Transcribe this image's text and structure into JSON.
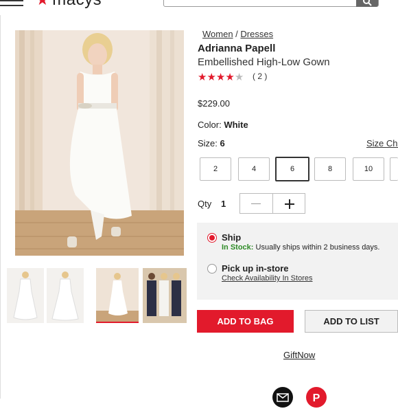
{
  "header": {
    "logo_text": "macys"
  },
  "breadcrumb": {
    "level1": "Women",
    "separator": " / ",
    "level2": "Dresses"
  },
  "product": {
    "brand": "Adrianna Papell",
    "name": "Embellished High-Low Gown",
    "rating_value": 4,
    "rating_max": 5,
    "review_count": "( 2 )",
    "price": "$229.00",
    "color_label": "Color:",
    "color_value": "White",
    "size_label": "Size:",
    "size_value": "6",
    "size_chart_label": "Size Cha"
  },
  "sizes": [
    "2",
    "4",
    "6",
    "8",
    "10"
  ],
  "selected_size": "6",
  "quantity": {
    "label": "Qty",
    "value": "1"
  },
  "fulfillment": {
    "ship_title": "Ship",
    "stock_label": "In Stock:",
    "stock_text": " Usually ships within 2 business days.",
    "pickup_title": "Pick up in-store",
    "pickup_link": "Check Availability In Stores"
  },
  "actions": {
    "add_to_bag": "ADD TO BAG",
    "add_to_list": "ADD TO LIST",
    "giftnow": "GiftNow"
  },
  "colors": {
    "brand_red": "#e21a2c",
    "in_stock_green": "#2e8b27",
    "panel_gray": "#f2f2f2"
  },
  "icons": [
    "hamburger-icon",
    "search-icon",
    "star-icon",
    "minus-icon",
    "plus-icon",
    "mail-icon",
    "pinterest-icon"
  ]
}
